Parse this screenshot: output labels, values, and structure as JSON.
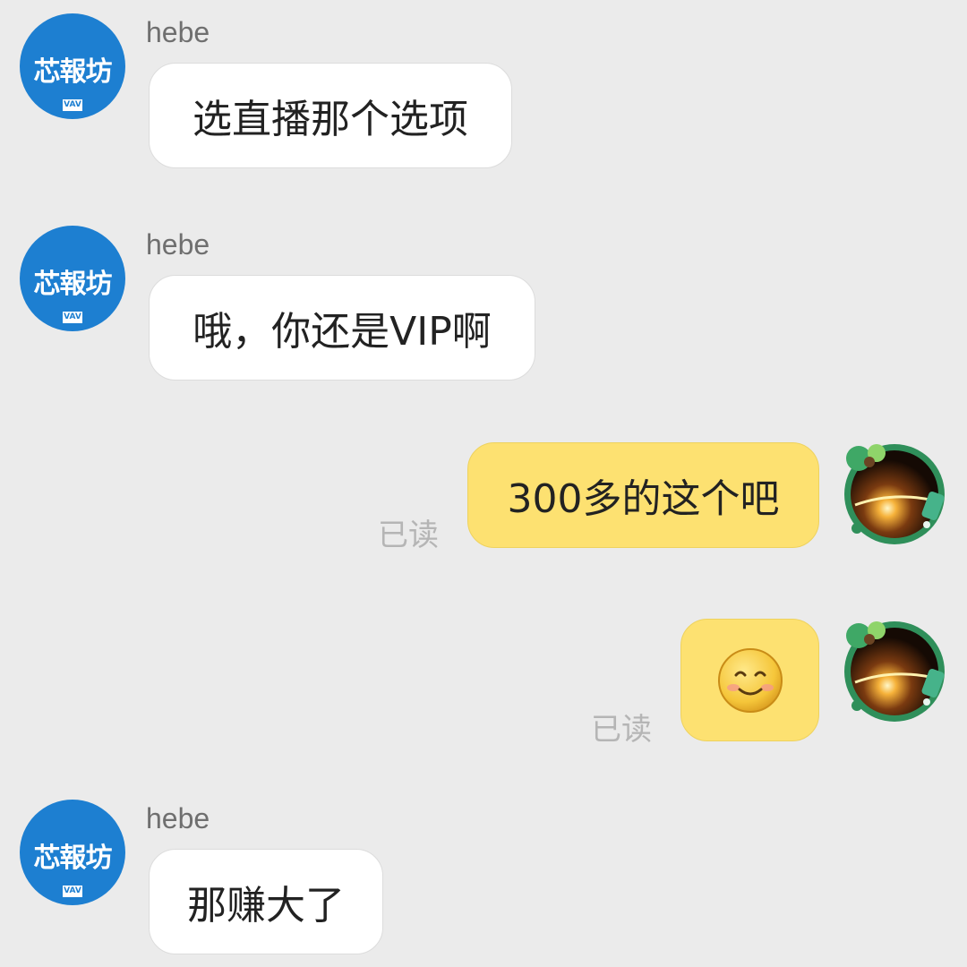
{
  "contact": {
    "name": "hebe",
    "avatar_logo_text": "芯報坊",
    "avatar_logo_sub": "VAV"
  },
  "messages": [
    {
      "direction": "in",
      "sender": "hebe",
      "text": "选直播那个选项"
    },
    {
      "direction": "in",
      "sender": "hebe",
      "text": "哦，你还是VIP啊"
    },
    {
      "direction": "out",
      "text": "300多的这个吧",
      "status": "已读"
    },
    {
      "direction": "out",
      "emoji": "smile-emoji",
      "status": "已读"
    },
    {
      "direction": "in",
      "sender": "hebe",
      "text": "那赚大了"
    }
  ],
  "colors": {
    "background": "#ebebeb",
    "incoming_bubble": "#ffffff",
    "outgoing_bubble": "#fde171",
    "avatar_blue": "#1d7fd1",
    "read_status": "#b5b5b5"
  }
}
